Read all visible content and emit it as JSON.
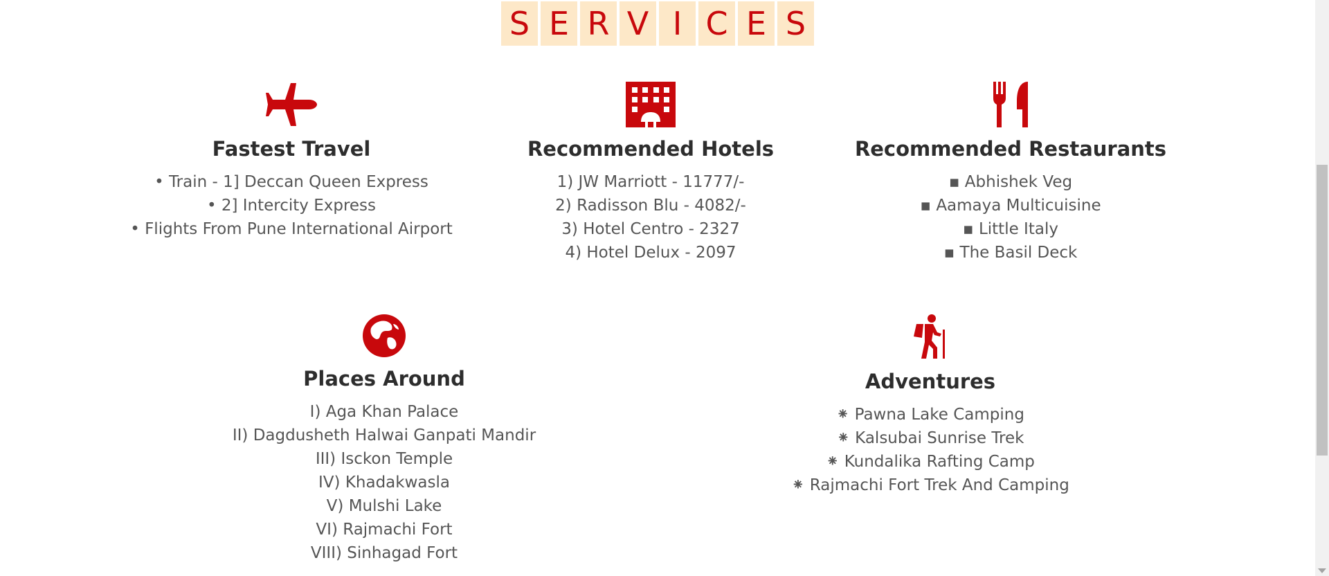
{
  "section_title_letters": [
    "S",
    "E",
    "R",
    "V",
    "I",
    "C",
    "E",
    "S"
  ],
  "accent_color": "#c8080c",
  "tile_color": "#fde8c8",
  "cards": {
    "travel": {
      "icon": "airplane-icon",
      "title": "Fastest Travel",
      "marker": "•",
      "items": [
        "Train - 1] Deccan Queen Express",
        "2] Intercity Express",
        "Flights From Pune International Airport"
      ]
    },
    "hotels": {
      "icon": "hotel-icon",
      "title": "Recommended Hotels",
      "items": [
        "1) JW Marriott - 11777/-",
        "2) Radisson Blu - 4082/-",
        "3) Hotel Centro - 2327",
        "4) Hotel Delux - 2097"
      ]
    },
    "restaurants": {
      "icon": "fork-knife-icon",
      "title": "Recommended Restaurants",
      "marker": "▪",
      "items": [
        "Abhishek Veg",
        "Aamaya Multicuisine",
        "Little Italy",
        "The Basil Deck"
      ]
    },
    "places": {
      "icon": "globe-icon",
      "title": "Places Around",
      "items": [
        "I) Aga Khan Palace",
        "II) Dagdusheth Halwai Ganpati Mandir",
        "III) Isckon Temple",
        "IV) Khadakwasla",
        "V) Mulshi Lake",
        "VI) Rajmachi Fort",
        "VIII) Sinhagad Fort"
      ]
    },
    "adventures": {
      "icon": "hiker-icon",
      "title": "Adventures",
      "marker": "⁕",
      "items": [
        "Pawna Lake Camping",
        "Kalsubai Sunrise Trek",
        "Kundalika Rafting Camp",
        "Rajmachi Fort Trek And Camping"
      ]
    }
  }
}
